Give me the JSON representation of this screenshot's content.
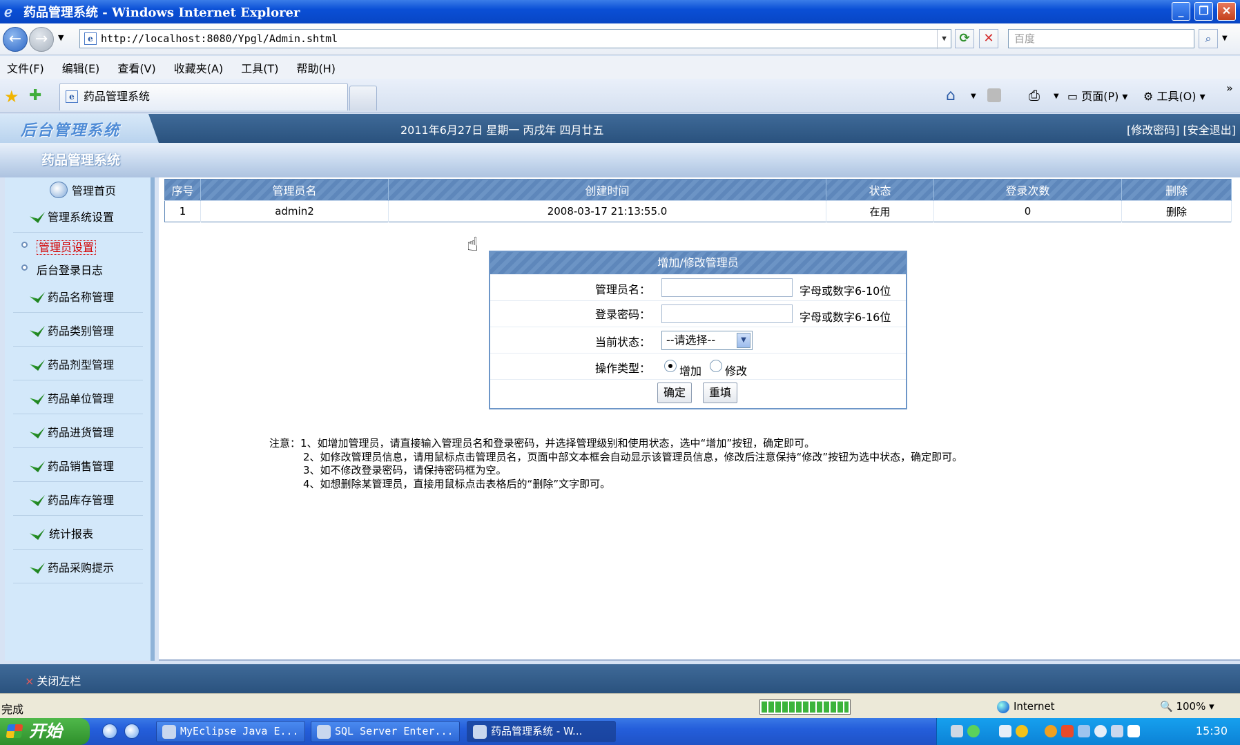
{
  "window": {
    "title": "药品管理系统 - Windows Internet Explorer"
  },
  "browser": {
    "url": "http://localhost:8080/Ypgl/Admin.shtml",
    "search_placeholder": "百度",
    "menu": [
      "文件(F)",
      "编辑(E)",
      "查看(V)",
      "收藏夹(A)",
      "工具(T)",
      "帮助(H)"
    ],
    "tab_title": "药品管理系统",
    "page_menu": "页面(P)",
    "tools_menu": "工具(O)"
  },
  "header": {
    "logo": "后台管理系统",
    "date": "2011年6月27日 星期一 丙戌年 四月廿五",
    "links": "[修改密码] [安全退出]",
    "subtitle": "药品管理系统"
  },
  "sidebar": {
    "home": "管理首页",
    "system_settings": "管理系统设置",
    "sub_items": [
      "管理员设置",
      "后台登录日志"
    ],
    "items": [
      "药品名称管理",
      "药品类别管理",
      "药品剂型管理",
      "药品单位管理",
      "药品进货管理",
      "药品销售管理",
      "药品库存管理",
      "统计报表",
      "药品采购提示"
    ],
    "close_left": "关闭左栏"
  },
  "table": {
    "headers": [
      "序号",
      "管理员名",
      "创建时间",
      "状态",
      "登录次数",
      "删除"
    ],
    "rows": [
      [
        "1",
        "admin2",
        "2008-03-17 21:13:55.0",
        "在用",
        "0",
        "删除"
      ]
    ]
  },
  "form": {
    "title": "增加/修改管理员",
    "username_label": "管理员名：",
    "username_hint": "字母或数字6-10位",
    "password_label": "登录密码：",
    "password_hint": "字母或数字6-16位",
    "status_label": "当前状态：",
    "status_selected": "--请选择--",
    "op_label": "操作类型：",
    "op_add": "增加",
    "op_edit": "修改",
    "submit": "确定",
    "reset": "重填"
  },
  "notes": [
    "注意：1、如增加管理员，请直接输入管理员名和登录密码，并选择管理级别和使用状态，选中“增加”按钮，确定即可。",
    "2、如修改管理员信息，请用鼠标点击管理员名，页面中部文本框会自动显示该管理员信息，修改后注意保持“修改”按钮为选中状态，确定即可。",
    "3、如不修改登录密码，请保持密码框为空。",
    "4、如想删除某管理员，直接用鼠标点击表格后的“删除”文字即可。"
  ],
  "statusbar": {
    "text": "完成",
    "zone": "Internet",
    "zoom": "100%"
  },
  "taskbar": {
    "start": "开始",
    "tasks": [
      "MyEclipse Java E...",
      "SQL Server Enter...",
      "药品管理系统 - W..."
    ],
    "clock": "15:30"
  },
  "colors": {
    "accent": "#2a527e",
    "table_header": "#6c94c5",
    "sidebar_bg": "#d3e8fa",
    "active_link": "#d40000"
  }
}
